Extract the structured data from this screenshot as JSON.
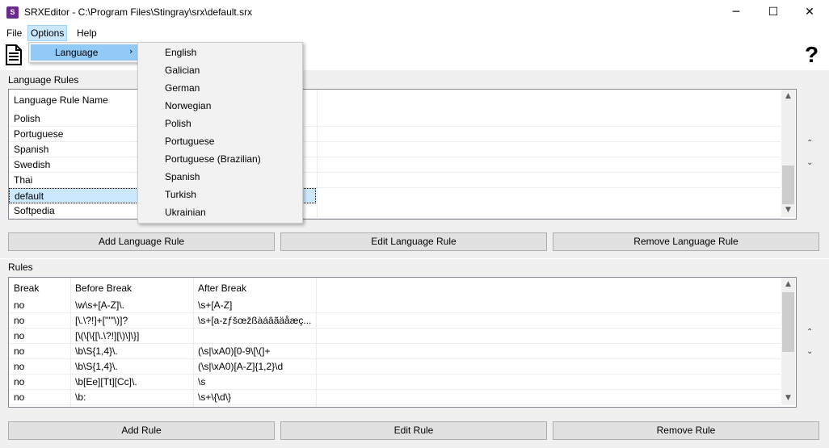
{
  "window": {
    "title": "SRXEditor - C:\\Program Files\\Stingray\\srx\\default.srx",
    "icon_text": "S",
    "minimize_glyph": "─",
    "maximize_glyph": "☐",
    "close_glyph": "✕"
  },
  "menubar": {
    "file": "File",
    "options": "Options",
    "help": "Help"
  },
  "options_menu": {
    "language_label": "Language",
    "submenu_arrow": "›"
  },
  "language_submenu": [
    "English",
    "Galician",
    "German",
    "Norwegian",
    "Polish",
    "Portuguese",
    "Portuguese (Brazilian)",
    "Spanish",
    "Turkish",
    "Ukrainian"
  ],
  "toolbar": {
    "help_glyph": "?"
  },
  "language_rules": {
    "group_label": "Language Rules",
    "column_header": "Language Rule Name",
    "rows": [
      "Polish",
      "Portuguese",
      "Spanish",
      "Swedish",
      "Thai",
      "default",
      "Softpedia"
    ],
    "selected_index": 5,
    "buttons": {
      "add": "Add Language Rule",
      "edit": "Edit Language Rule",
      "remove": "Remove Language Rule"
    }
  },
  "rules": {
    "group_label": "Rules",
    "columns": [
      "Break",
      "Before Break",
      "After Break"
    ],
    "rows": [
      [
        "no",
        "\\w\\s+[A-Z]\\.",
        "\\s+[A-Z]"
      ],
      [
        "no",
        "[\\.\\?!]+[\"'\"\\)]?",
        "\\s+[a-zƒšœžßàáâãäåæç..."
      ],
      [
        "no",
        "[\\(\\[\\{[\\.\\?!][\\)\\]\\}]",
        ""
      ],
      [
        "no",
        "\\b\\S{1,4}\\.",
        "(\\s|\\xA0)[0-9\\[\\(]+"
      ],
      [
        "no",
        "\\b\\S{1,4}\\.",
        "(\\s|\\xA0)[A-Z]{1,2}\\d"
      ],
      [
        "no",
        "\\b[Ee][Tt][Cc]\\.",
        "\\s"
      ],
      [
        "no",
        "\\b:",
        "\\s+\\{\\d\\}"
      ]
    ],
    "buttons": {
      "add": "Add Rule",
      "edit": "Edit Rule",
      "remove": "Remove Rule"
    }
  },
  "scroll": {
    "up": "▲",
    "down": "▼"
  },
  "side_arrows": {
    "up": "⌃",
    "down": "⌄"
  }
}
